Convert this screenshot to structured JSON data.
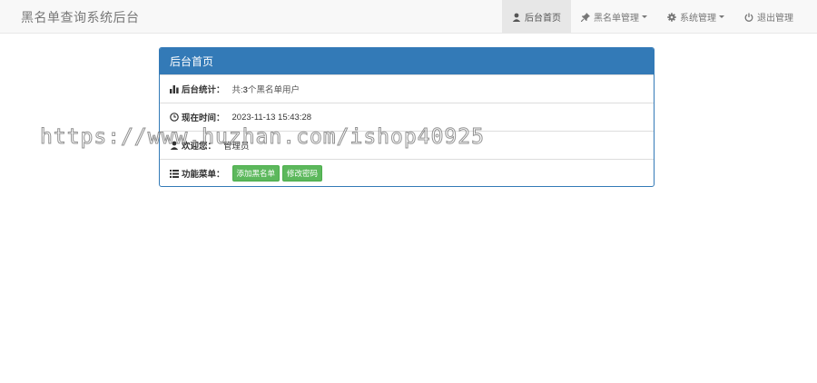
{
  "navbar": {
    "brand": "黑名单查询系统后台",
    "items": [
      {
        "label": "后台首页",
        "icon": "user-icon",
        "active": true
      },
      {
        "label": "黑名单管理",
        "icon": "pin-icon",
        "dropdown": true
      },
      {
        "label": "系统管理",
        "icon": "gear-icon",
        "dropdown": true
      },
      {
        "label": "退出管理",
        "icon": "power-icon"
      }
    ]
  },
  "panel": {
    "title": "后台首页",
    "stats": {
      "label": "后台统计：",
      "prefix": "共:",
      "count": "3",
      "suffix": "个黑名单用户",
      "icon": "bar-chart-icon"
    },
    "time": {
      "label": "现在时间：",
      "value": "2023-11-13 15:43:28",
      "icon": "clock-icon"
    },
    "welcome": {
      "label": "欢迎您：",
      "value": "管理员",
      "icon": "user-icon"
    },
    "menu": {
      "label": "功能菜单：",
      "icon": "list-icon",
      "buttons": [
        "添加黑名单",
        "修改密码"
      ]
    }
  },
  "watermark": "https://www.huzhan.com/ishop40925",
  "colors": {
    "primary": "#337ab7",
    "success": "#5cb85c",
    "navbar_bg": "#f8f8f8"
  }
}
